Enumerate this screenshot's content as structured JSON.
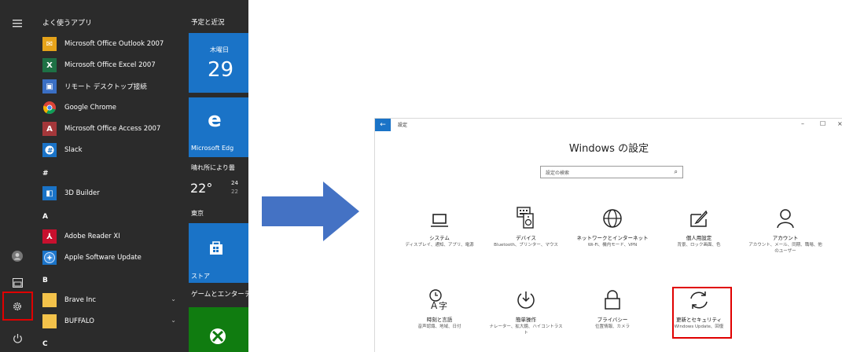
{
  "start_menu": {
    "most_used_header": "よく使うアプリ",
    "apps_top": [
      {
        "label": "Microsoft Office Outlook 2007",
        "icon": "outlook-icon"
      },
      {
        "label": "Microsoft Office Excel 2007",
        "icon": "excel-icon"
      },
      {
        "label": "リモート デスクトップ接続",
        "icon": "remote-desktop-icon"
      },
      {
        "label": "Google Chrome",
        "icon": "chrome-icon"
      },
      {
        "label": "Microsoft Office Access 2007",
        "icon": "access-icon"
      },
      {
        "label": "Slack",
        "icon": "slack-icon"
      }
    ],
    "letter_hash": "#",
    "app_3d": "3D Builder",
    "letter_a": "A",
    "app_adobe": "Adobe Reader XI",
    "app_apple": "Apple Software Update",
    "letter_b": "B",
    "app_brave": "Brave Inc",
    "app_buffalo": "BUFFALO",
    "letter_c": "C",
    "tiles": {
      "header_schedule": "予定と近況",
      "calendar_day": "木曜日",
      "calendar_date": "29",
      "edge_label": "Microsoft Edg",
      "weather_desc": "晴れ所により曇",
      "weather_temp": "22°",
      "weather_hi": "24",
      "weather_lo": "22",
      "weather_city": "東京",
      "store_label": "ストア",
      "header_games": "ゲームとエンターテ"
    }
  },
  "settings": {
    "window_title": "設定",
    "heading": "Windows の設定",
    "search_placeholder": "設定の検索",
    "categories": [
      {
        "name": "システム",
        "desc": "ディスプレイ、通知、アプリ、電源",
        "icon": "laptop-icon"
      },
      {
        "name": "デバイス",
        "desc": "Bluetooth、プリンター、マウス",
        "icon": "keyboard-speaker-icon"
      },
      {
        "name": "ネットワークとインターネット",
        "desc": "Wi-Fi、機内モード、VPN",
        "icon": "globe-icon"
      },
      {
        "name": "個人用設定",
        "desc": "背景、ロック画面、色",
        "icon": "paint-icon"
      },
      {
        "name": "アカウント",
        "desc": "アカウント、メール、同期、職場、他のユーザー",
        "icon": "person-icon"
      },
      {
        "name": "時刻と言語",
        "desc": "音声認識、地域、日付",
        "icon": "time-language-icon"
      },
      {
        "name": "簡単操作",
        "desc": "ナレーター、拡大鏡、ハイコントラスト",
        "icon": "ease-of-access-icon"
      },
      {
        "name": "プライバシー",
        "desc": "位置情報、カメラ",
        "icon": "lock-icon"
      },
      {
        "name": "更新とセキュリティ",
        "desc": "Windows Update、回復",
        "icon": "sync-icon"
      }
    ]
  },
  "colors": {
    "start_bg": "#2b2b2b",
    "tile_blue": "#1a73c7",
    "arrow": "#4472c4",
    "highlight": "#e00000",
    "xbox_green": "#107c10"
  }
}
